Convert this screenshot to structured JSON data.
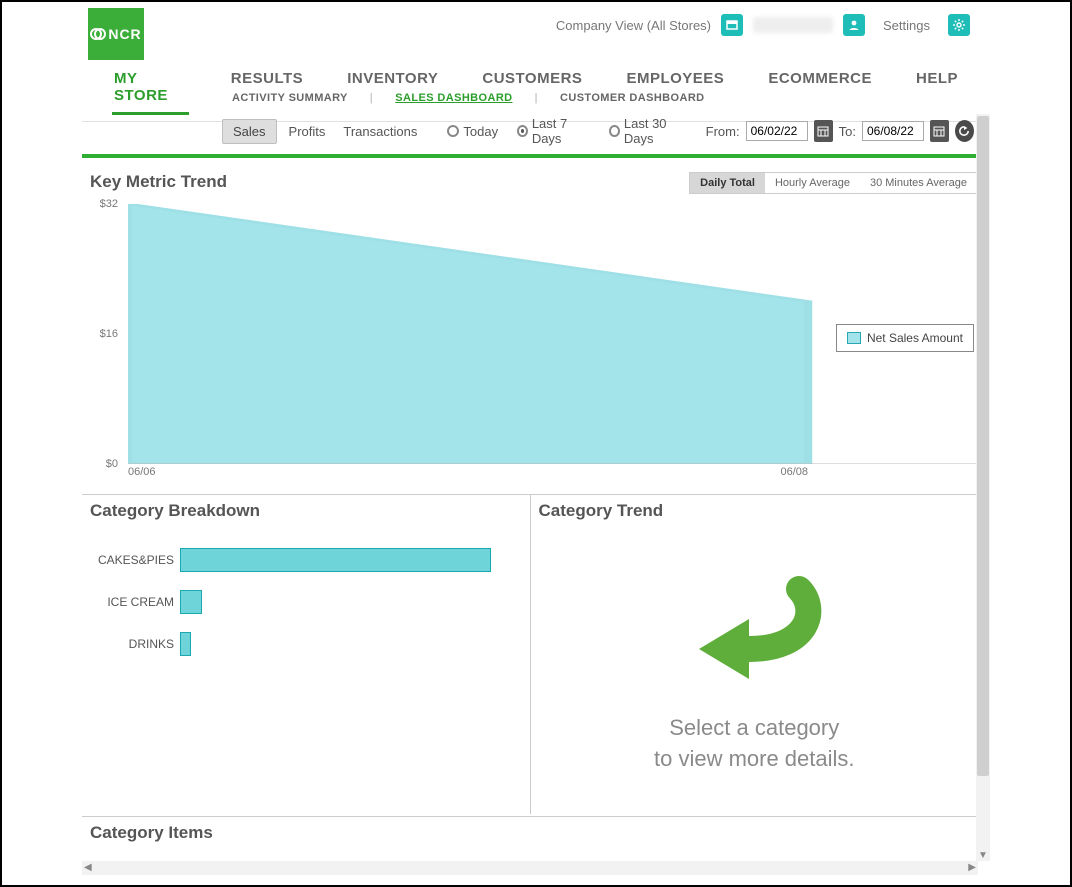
{
  "brand": "NCR",
  "header": {
    "company_view": "Company View (All Stores)",
    "settings": "Settings"
  },
  "nav": {
    "items": [
      "MY STORE",
      "RESULTS",
      "INVENTORY",
      "CUSTOMERS",
      "EMPLOYEES",
      "ECOMMERCE",
      "HELP"
    ],
    "active_index": 0
  },
  "subnav": {
    "items": [
      "ACTIVITY SUMMARY",
      "SALES DASHBOARD",
      "CUSTOMER DASHBOARD"
    ],
    "active_index": 1
  },
  "controls": {
    "tabs": [
      "Sales",
      "Profits",
      "Transactions"
    ],
    "tabs_active": 0,
    "ranges": [
      "Today",
      "Last 7 Days",
      "Last 30 Days"
    ],
    "range_selected": 1,
    "from_label": "From:",
    "to_label": "To:",
    "from": "06/02/22",
    "to": "06/08/22"
  },
  "metric": {
    "title": "Key Metric Trend",
    "toggles": [
      "Daily Total",
      "Hourly Average",
      "30 Minutes Average"
    ],
    "toggle_selected": 0,
    "legend": "Net Sales Amount"
  },
  "chart_data": {
    "type": "area",
    "x": [
      "06/06",
      "06/08"
    ],
    "series": [
      {
        "name": "Net Sales Amount",
        "values": [
          32,
          20
        ]
      }
    ],
    "y_ticks": [
      0,
      16,
      32
    ],
    "y_tick_labels": [
      "$0",
      "$16",
      "$32"
    ],
    "ylim": [
      0,
      32
    ],
    "xlabel": "",
    "ylabel": "",
    "title": ""
  },
  "breakdown": {
    "title": "Category Breakdown",
    "type": "bar",
    "categories": [
      "CAKES&PIES",
      "ICE CREAM",
      "DRINKS"
    ],
    "values": [
      42,
      3,
      1.5
    ],
    "xlim": [
      0,
      46
    ]
  },
  "trend": {
    "title": "Category Trend",
    "hint1": "Select a category",
    "hint2": "to view more details."
  },
  "items": {
    "title": "Category Items"
  }
}
